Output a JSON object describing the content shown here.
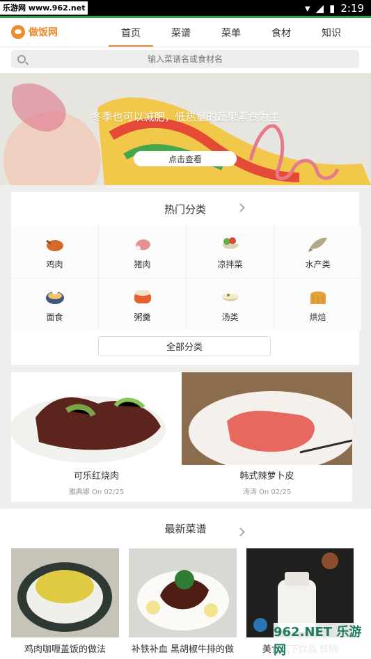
{
  "status_bar": {
    "watermark": "乐游网 www.962.net",
    "time": "2:19"
  },
  "app": {
    "name": "做饭网",
    "brand_color": "#e98a29"
  },
  "nav": [
    {
      "label": "首页",
      "active": true
    },
    {
      "label": "菜谱"
    },
    {
      "label": "菜单"
    },
    {
      "label": "食材"
    },
    {
      "label": "知识"
    }
  ],
  "search": {
    "placeholder": "输入菜谱名或食材名"
  },
  "banner": {
    "caption": "冬季也可以减肥，低热量的蔬果素食为主",
    "button_label": "点击查看"
  },
  "hot_categories": {
    "title": "热门分类",
    "items": [
      {
        "label": "鸡肉",
        "icon": "roast-chicken-icon"
      },
      {
        "label": "猪肉",
        "icon": "pork-leg-icon"
      },
      {
        "label": "凉拌菜",
        "icon": "salad-bowl-icon"
      },
      {
        "label": "水产类",
        "icon": "fish-icon"
      },
      {
        "label": "面食",
        "icon": "noodle-bowl-icon"
      },
      {
        "label": "粥羹",
        "icon": "porridge-pot-icon"
      },
      {
        "label": "汤类",
        "icon": "soup-bowl-icon"
      },
      {
        "label": "烘焙",
        "icon": "bread-icon"
      }
    ],
    "all_button": "全部分类"
  },
  "featured": [
    {
      "title": "可乐红烧肉",
      "author": "雅典娜",
      "date_text": "On 02/25"
    },
    {
      "title": "韩式辣萝卜皮",
      "author": "涛涛",
      "date_text": "On 02/25"
    }
  ],
  "latest": {
    "title": "最新菜谱",
    "items": [
      {
        "title": "鸡肉咖喱盖饭的做法"
      },
      {
        "title": "补铁补血 黑胡椒牛排的做"
      },
      {
        "title": "美食天下饮品 核桃"
      }
    ]
  },
  "watermark_bottom": "962.NET 乐游网"
}
